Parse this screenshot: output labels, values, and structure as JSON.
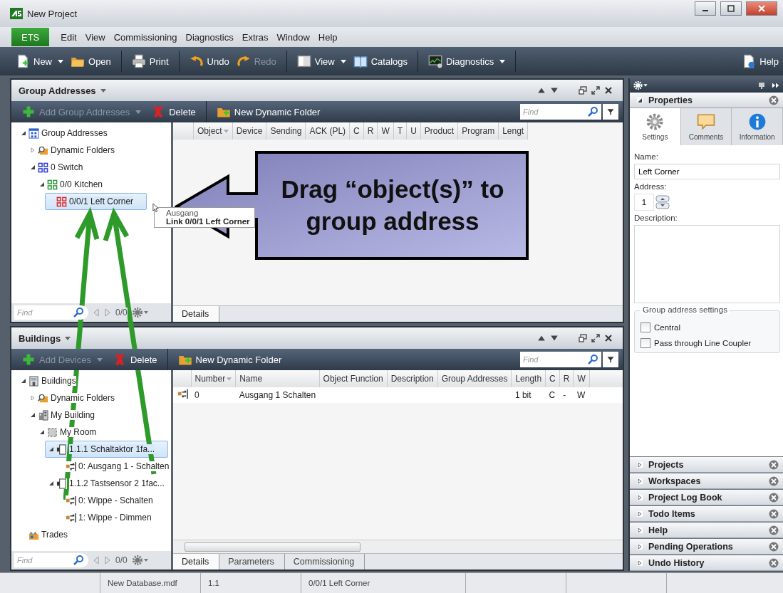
{
  "window": {
    "title": "New Project"
  },
  "app_button": "ETS",
  "menu": [
    "Edit",
    "View",
    "Commissioning",
    "Diagnostics",
    "Extras",
    "Window",
    "Help"
  ],
  "toolbar": {
    "groups": [
      {
        "buttons": [
          {
            "kind": "new",
            "label": "New",
            "dropdown": true,
            "disabled": false
          },
          {
            "kind": "open",
            "label": "Open",
            "dropdown": false,
            "disabled": false
          }
        ]
      },
      {
        "buttons": [
          {
            "kind": "print",
            "label": "Print",
            "dropdown": false,
            "disabled": false
          }
        ]
      },
      {
        "buttons": [
          {
            "kind": "undo",
            "label": "Undo",
            "dropdown": false,
            "disabled": false
          },
          {
            "kind": "redo",
            "label": "Redo",
            "dropdown": false,
            "disabled": true
          }
        ]
      },
      {
        "buttons": [
          {
            "kind": "view",
            "label": "View",
            "dropdown": true,
            "disabled": false
          },
          {
            "kind": "catalogs",
            "label": "Catalogs",
            "dropdown": false,
            "disabled": false
          }
        ]
      },
      {
        "buttons": [
          {
            "kind": "diagnostics",
            "label": "Diagnostics",
            "dropdown": true,
            "disabled": false
          }
        ]
      }
    ],
    "help": {
      "kind": "help",
      "label": "Help"
    }
  },
  "panels": [
    {
      "title": "Group Addresses",
      "tools": [
        {
          "kind": "add",
          "label": "Add Group Addresses",
          "dropdown": true,
          "disabled": true
        },
        {
          "kind": "delete",
          "label": "Delete",
          "dropdown": false,
          "disabled": false
        },
        {
          "kind": "folder",
          "label": "New Dynamic Folder",
          "dropdown": false,
          "disabled": false
        }
      ],
      "find": {
        "placeholder": "Find"
      },
      "tree": [
        {
          "label": "Group Addresses",
          "kind": "ga_root",
          "expanded": true,
          "selected": false,
          "children": [
            {
              "label": "Dynamic Folders",
              "kind": "dynamic",
              "expanded": false,
              "selected": false
            },
            {
              "label": "0 Switch",
              "kind": "ga_main",
              "expanded": true,
              "selected": false,
              "children": [
                {
                  "label": "0/0 Kitchen",
                  "kind": "ga_middle",
                  "expanded": true,
                  "selected": false,
                  "children": [
                    {
                      "label": "0/0/1 Left Corner",
                      "kind": "ga_address",
                      "selected": true
                    }
                  ]
                }
              ]
            }
          ]
        }
      ],
      "tree_find": {
        "placeholder": "Find"
      },
      "counter": "0/0",
      "columns": [
        {
          "label": "Object",
          "sorted": true
        },
        {
          "label": "Device",
          "sorted": false
        },
        {
          "label": "Sending",
          "sorted": false
        },
        {
          "label": "ACK (PL)",
          "sorted": false
        },
        {
          "label": "C",
          "sorted": false
        },
        {
          "label": "R",
          "sorted": false
        },
        {
          "label": "W",
          "sorted": false
        },
        {
          "label": "T",
          "sorted": false
        },
        {
          "label": "U",
          "sorted": false
        },
        {
          "label": "Product",
          "sorted": false
        },
        {
          "label": "Program",
          "sorted": false
        },
        {
          "label": "Lengt",
          "sorted": false
        }
      ],
      "tabs": [
        {
          "label": "Details",
          "selected": true
        }
      ]
    },
    {
      "title": "Buildings",
      "tools": [
        {
          "kind": "add",
          "label": "Add Devices",
          "dropdown": true,
          "disabled": true
        },
        {
          "kind": "delete",
          "label": "Delete",
          "dropdown": false,
          "disabled": false
        },
        {
          "kind": "folder",
          "label": "New Dynamic Folder",
          "dropdown": false,
          "disabled": false
        }
      ],
      "find": {
        "placeholder": "Find"
      },
      "tree": [
        {
          "label": "Buildings",
          "kind": "building_root",
          "expanded": true,
          "selected": false,
          "children": [
            {
              "label": "Dynamic Folders",
              "kind": "dynamic",
              "expanded": false,
              "selected": false
            },
            {
              "label": "My Building",
              "kind": "building",
              "expanded": true,
              "selected": false,
              "children": [
                {
                  "label": "My Room",
                  "kind": "room",
                  "expanded": true,
                  "selected": false,
                  "children": [
                    {
                      "label": "1.1.1 Schaltaktor 1fa...",
                      "kind": "device",
                      "expanded": true,
                      "selected": true,
                      "children": [
                        {
                          "label": "0: Ausgang 1 - Schalten",
                          "kind": "object",
                          "selected": false
                        }
                      ]
                    },
                    {
                      "label": "1.1.2 Tastsensor 2 1fac...",
                      "kind": "device",
                      "expanded": true,
                      "selected": false,
                      "children": [
                        {
                          "label": "0: Wippe - Schalten",
                          "kind": "object",
                          "selected": false
                        },
                        {
                          "label": "1: Wippe - Dimmen",
                          "kind": "object",
                          "selected": false
                        }
                      ]
                    }
                  ]
                }
              ]
            }
          ]
        },
        {
          "label": "Trades",
          "kind": "trades",
          "selected": false
        }
      ],
      "tree_find": {
        "placeholder": "Find"
      },
      "counter": "0/0",
      "columns": [
        {
          "label": "Number",
          "sorted": true
        },
        {
          "label": "Name",
          "sorted": false
        },
        {
          "label": "Object Function",
          "sorted": false
        },
        {
          "label": "Description",
          "sorted": false
        },
        {
          "label": "Group Addresses",
          "sorted": false
        },
        {
          "label": "Length",
          "sorted": false
        },
        {
          "label": "C",
          "sorted": false
        },
        {
          "label": "R",
          "sorted": false
        },
        {
          "label": "W",
          "sorted": false
        }
      ],
      "rows": [
        {
          "kind": "object",
          "cells": [
            "0",
            "Ausgang 1 Schalten",
            null,
            null,
            null,
            "1 bit",
            "C",
            "-",
            "W"
          ]
        }
      ],
      "h_scrollbar": true,
      "tabs": [
        {
          "label": "Details",
          "selected": true
        },
        {
          "label": "Parameters",
          "selected": false
        },
        {
          "label": "Commissioning",
          "selected": false
        }
      ]
    }
  ],
  "side_panel": {
    "properties": {
      "title": "Properties",
      "expanded": true,
      "tabs": [
        {
          "kind": "settings",
          "label": "Settings",
          "selected": true
        },
        {
          "kind": "comments",
          "label": "Comments",
          "selected": false
        },
        {
          "kind": "information",
          "label": "Information",
          "selected": false
        }
      ],
      "name": {
        "label": "Name:",
        "value": "Left Corner"
      },
      "address": {
        "label": "Address:",
        "value": "1"
      },
      "description": {
        "label": "Description:"
      },
      "group_box": {
        "title": "Group address settings",
        "options": [
          {
            "label": "Central",
            "checked": false
          },
          {
            "label": "Pass through Line Coupler",
            "checked": false
          }
        ]
      }
    },
    "sections": [
      {
        "title": "Projects",
        "expanded": false
      },
      {
        "title": "Workspaces",
        "expanded": false
      },
      {
        "title": "Project Log Book",
        "expanded": false
      },
      {
        "title": "Todo Items",
        "expanded": false
      },
      {
        "title": "Help",
        "expanded": false
      },
      {
        "title": "Pending Operations",
        "expanded": false
      },
      {
        "title": "Undo History",
        "expanded": false
      }
    ]
  },
  "callout": {
    "text": "Drag “object(s)” to group address"
  },
  "drag_tooltip": {
    "item": "Ausgang",
    "action": "Link 0/0/1 Left Corner"
  },
  "status_bar": [
    "New Database.mdf",
    "1.1",
    "0/0/1 Left Corner"
  ]
}
